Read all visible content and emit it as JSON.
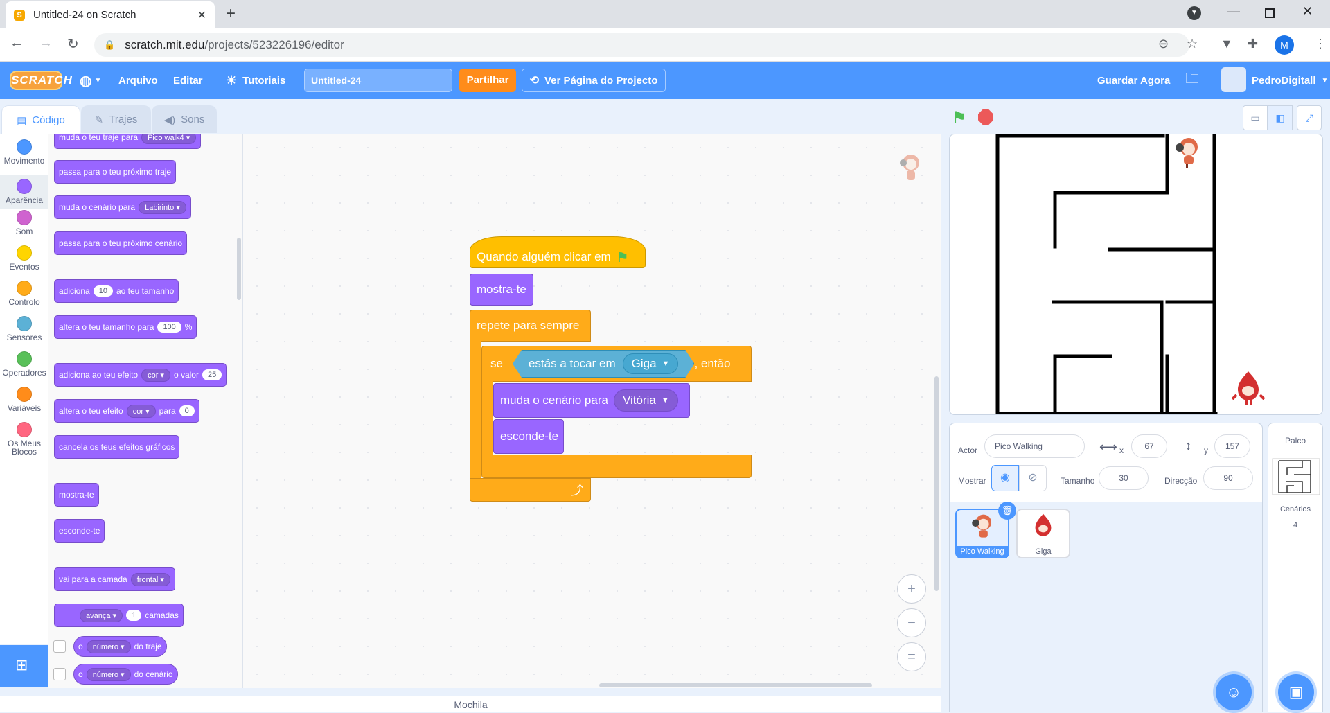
{
  "browser": {
    "tab_title": "Untitled-24 on Scratch",
    "tab_close": "✕",
    "new_tab": "+",
    "url_host": "scratch.mit.edu",
    "url_path": "/projects/523226196/editor",
    "profile_initial": "M"
  },
  "menu": {
    "logo": "SCRATCH",
    "file": "Arquivo",
    "edit": "Editar",
    "tutorials": "Tutoriais",
    "project_title": "Untitled-24",
    "share": "Partilhar",
    "see_project": "Ver Página do Projecto",
    "save_now": "Guardar Agora",
    "username": "PedroDigitall"
  },
  "editor_tabs": {
    "code": "Código",
    "costumes": "Trajes",
    "sounds": "Sons"
  },
  "categories": [
    {
      "label": "Movimento",
      "color": "#4c97ff"
    },
    {
      "label": "Aparência",
      "color": "#9966ff"
    },
    {
      "label": "Som",
      "color": "#cf63cf"
    },
    {
      "label": "Eventos",
      "color": "#ffd500"
    },
    {
      "label": "Controlo",
      "color": "#ffab19"
    },
    {
      "label": "Sensores",
      "color": "#5cb1d6"
    },
    {
      "label": "Operadores",
      "color": "#59c059"
    },
    {
      "label": "Variáveis",
      "color": "#ff8c1a"
    },
    {
      "label": "Os Meus Blocos",
      "color": "#ff6680"
    }
  ],
  "palette": {
    "switch_costume": "muda o teu traje para",
    "costume_value": "Pico walk4",
    "next_costume": "passa para o teu próximo traje",
    "switch_backdrop": "muda o cenário para",
    "backdrop_value": "Labirinto",
    "next_backdrop": "passa para o teu próximo cenário",
    "change_size_a": "adiciona",
    "change_size_val": "10",
    "change_size_b": "ao teu tamanho",
    "set_size_a": "altera o teu tamanho para",
    "set_size_val": "100",
    "set_size_b": "%",
    "change_effect_a": "adiciona ao teu efeito",
    "effect_name": "cor",
    "change_effect_b": "o valor",
    "change_effect_val": "25",
    "set_effect_a": "altera o teu efeito",
    "set_effect_b": "para",
    "set_effect_val": "0",
    "clear_effects": "cancela os teus efeitos gráficos",
    "show": "mostra-te",
    "hide": "esconde-te",
    "go_layer_a": "vai para a camada",
    "layer_value": "frontal",
    "go_forward": "avança",
    "layers_val": "1",
    "layers_b": "camadas",
    "rep_costume_a": "o",
    "rep_costume_dd": "número",
    "rep_costume_b": "do traje",
    "rep_backdrop_a": "o",
    "rep_backdrop_dd": "número",
    "rep_backdrop_b": "do cenário"
  },
  "script": {
    "hat": "Quando alguém clicar em",
    "show": "mostra-te",
    "forever": "repete para sempre",
    "if": "se",
    "touching": "estás a tocar em",
    "touching_target": "Giga",
    "then": ", então",
    "switch_backdrop": "muda o cenário para",
    "backdrop_target": "Vitória",
    "hide": "esconde-te"
  },
  "zoom": {
    "in": "+",
    "out": "−",
    "reset": "="
  },
  "sprite_info": {
    "actor_label": "Actor",
    "actor_name": "Pico Walking",
    "x_label": "x",
    "x": "67",
    "y_label": "y",
    "y": "157",
    "show_label": "Mostrar",
    "size_label": "Tamanho",
    "size": "30",
    "direction_label": "Direcção",
    "direction": "90"
  },
  "sprites": [
    {
      "name": "Pico Walking",
      "selected": true
    },
    {
      "name": "Giga",
      "selected": false
    }
  ],
  "stage_panel": {
    "title": "Palco",
    "backdrops_label": "Cenários",
    "backdrops_count": "4"
  },
  "backpack": "Mochila",
  "colors": {
    "scratch_blue": "#4c97ff",
    "looks": "#9966ff",
    "control": "#ffab19",
    "events": "#ffbf00",
    "sensing": "#5cb1d6"
  }
}
